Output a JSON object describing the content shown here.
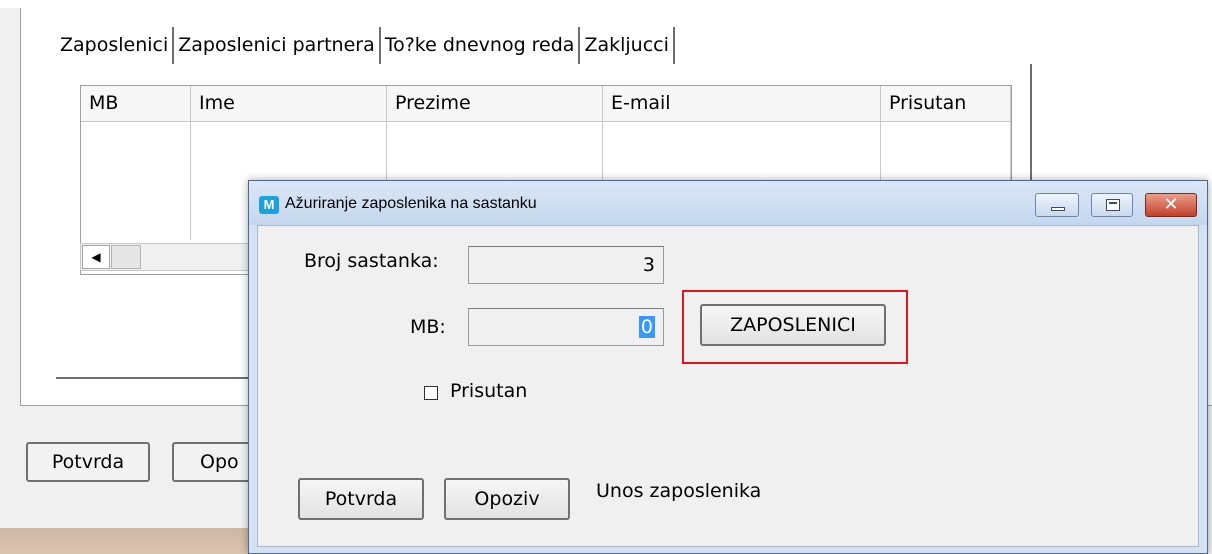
{
  "background_form": {
    "tabs": [
      "Zaposlenici",
      "Zaposlenici partnera",
      "To?ke dnevnog reda",
      "Zakljucci"
    ],
    "grid_columns": [
      "MB",
      "Ime",
      "Prezime",
      "E-mail",
      "Prisutan"
    ],
    "confirm_label": "Potvrda",
    "cancel_label": "Opo"
  },
  "dialog": {
    "title": "Ažuriranje zaposlenika na sastanku",
    "app_icon_letter": "M",
    "close_glyph": "✕",
    "meeting_no_label": "Broj sastanka:",
    "meeting_no_value": "3",
    "mb_label": "MB:",
    "mb_value": "0",
    "employees_button": "ZAPOSLENICI",
    "present_label": "Prisutan",
    "present_checked": false,
    "confirm_label": "Potvrda",
    "cancel_label": "Opoziv",
    "status_text": "Unos zaposlenika"
  },
  "colors": {
    "highlight": "#e0141e",
    "selection": "#3399ff",
    "titlebar": "#c4d6ee"
  },
  "icons": {
    "app": "app-m-icon",
    "minimize": "minimize-icon",
    "maximize": "maximize-icon",
    "close": "close-icon",
    "scroll_left": "scroll-left-arrow-icon"
  }
}
